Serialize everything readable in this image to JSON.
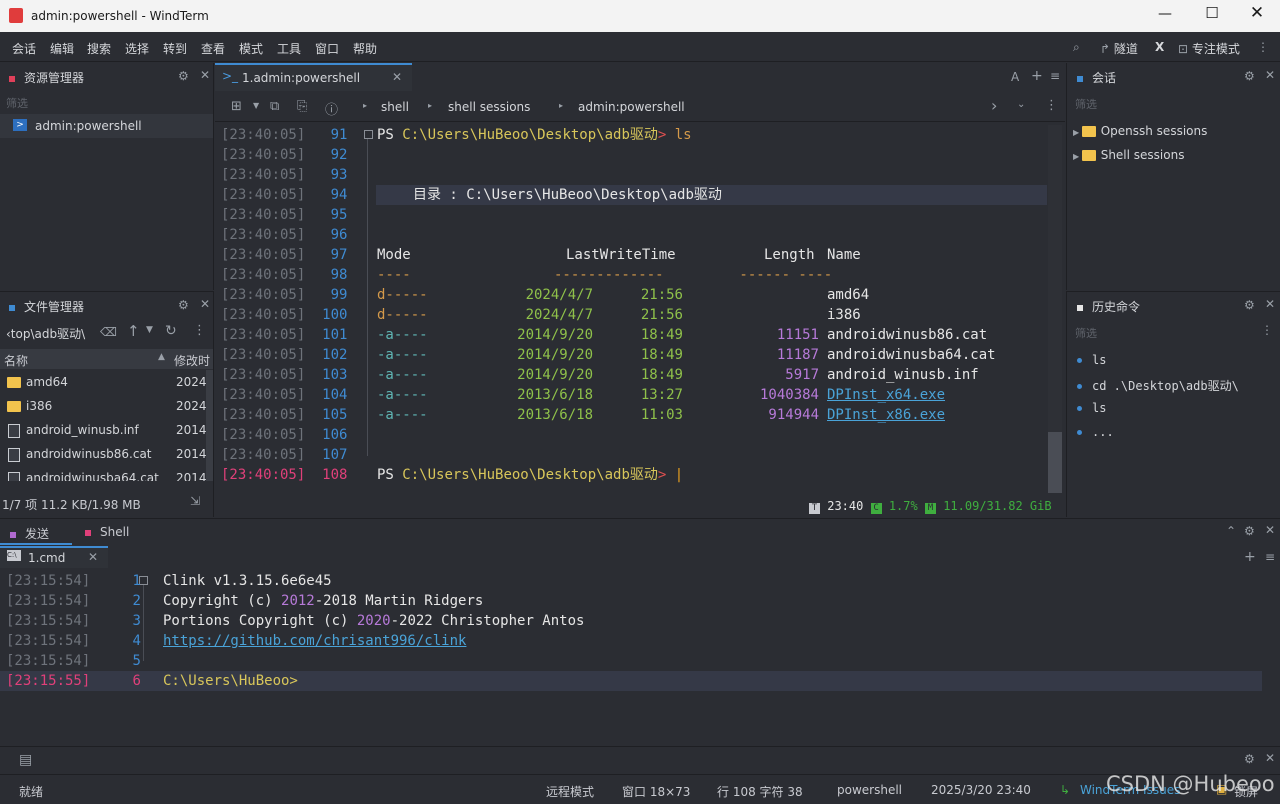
{
  "window": {
    "title": "admin:powershell - WindTerm"
  },
  "menu": [
    "会话",
    "编辑",
    "搜索",
    "选择",
    "转到",
    "查看",
    "模式",
    "工具",
    "窗口",
    "帮助"
  ],
  "menu_right": {
    "tunnel": "隧道",
    "focus": "专注模式",
    "x": "X"
  },
  "resource_panel": {
    "title": "资源管理器",
    "filter": "筛选",
    "item": "admin:powershell"
  },
  "file_panel": {
    "title": "文件管理器",
    "path": "‹top\\adb驱动\\",
    "col_name": "名称",
    "col_mod": "修改时",
    "files": [
      {
        "name": "amd64",
        "date": "2024",
        "type": "folder"
      },
      {
        "name": "i386",
        "date": "2024",
        "type": "folder"
      },
      {
        "name": "android_winusb.inf",
        "date": "2014",
        "type": "file"
      },
      {
        "name": "androidwinusb86.cat",
        "date": "2014",
        "type": "file"
      },
      {
        "name": "androidwinusba64.cat",
        "date": "2014",
        "type": "file"
      }
    ],
    "footer": "1/7 项 11.2 KB/1.98 MB"
  },
  "tab": {
    "label": "1.admin:powershell",
    "a": "A",
    "plus": "+",
    "menu": "≡"
  },
  "breadcrumb": [
    "shell",
    "shell sessions",
    "admin:powershell"
  ],
  "terminal": {
    "ts": "[23:40:05]",
    "prompt_path": "C:\\Users\\HuBeoo\\Desktop\\adb驱动",
    "cmd": "ls",
    "dir_label": "目录",
    "dir_path": "C:\\Users\\HuBeoo\\Desktop\\adb驱动",
    "headers": {
      "mode": "Mode",
      "lwt": "LastWriteTime",
      "len": "Length",
      "name": "Name"
    },
    "rows": [
      {
        "mode": "d-----",
        "date": "2024/4/7",
        "time": "21:56",
        "len": "",
        "name": "amd64",
        "link": false
      },
      {
        "mode": "d-----",
        "date": "2024/4/7",
        "time": "21:56",
        "len": "",
        "name": "i386",
        "link": false
      },
      {
        "mode": "-a----",
        "date": "2014/9/20",
        "time": "18:49",
        "len": "11151",
        "name": "androidwinusb86.cat",
        "link": false
      },
      {
        "mode": "-a----",
        "date": "2014/9/20",
        "time": "18:49",
        "len": "11187",
        "name": "androidwinusba64.cat",
        "link": false
      },
      {
        "mode": "-a----",
        "date": "2014/9/20",
        "time": "18:49",
        "len": "5917",
        "name": "android_winusb.inf",
        "link": false
      },
      {
        "mode": "-a----",
        "date": "2013/6/18",
        "time": "13:27",
        "len": "1040384",
        "name": "DPInst_x64.exe",
        "link": true
      },
      {
        "mode": "-a----",
        "date": "2013/6/18",
        "time": "11:03",
        "len": "914944",
        "name": "DPInst_x86.exe",
        "link": true
      }
    ],
    "status_time": "23:40",
    "status_cpu": "1.7%",
    "status_mem": "11.09/31.82 GiB"
  },
  "session_panel": {
    "title": "会话",
    "filter": "筛选",
    "items": [
      "Openssh sessions",
      "Shell sessions"
    ]
  },
  "history_panel": {
    "title": "历史命令",
    "filter": "筛选",
    "items": [
      "ls",
      "cd .\\Desktop\\adb驱动\\",
      "ls",
      "..."
    ]
  },
  "bottom_tabs": {
    "send": "发送",
    "shell": "Shell",
    "cmd_tab": "1.cmd"
  },
  "cmd_term": {
    "ts1": "[23:15:54]",
    "ts2": "[23:15:55]",
    "l1": "Clink v1.3.15.6e6e45",
    "l2a": "Copyright (c) ",
    "l2b": "2012",
    "l2c": "-2018 Martin Ridgers",
    "l3a": "Portions Copyright (c) ",
    "l3b": "2020",
    "l3c": "-2022 Christopher Antos",
    "l4": "https://github.com/chrisant996/clink",
    "l6": "C:\\Users\\HuBeoo>"
  },
  "statusbar": {
    "ready": "就绪",
    "remote": "远程模式",
    "win": "窗口 18×73",
    "pos": "行 108 字符 38",
    "shell": "powershell",
    "datetime": "2025/3/20 23:40",
    "issues": "WindTerm Issues",
    "lock": "锁屏"
  },
  "watermark": "CSDN @Hubeoo"
}
